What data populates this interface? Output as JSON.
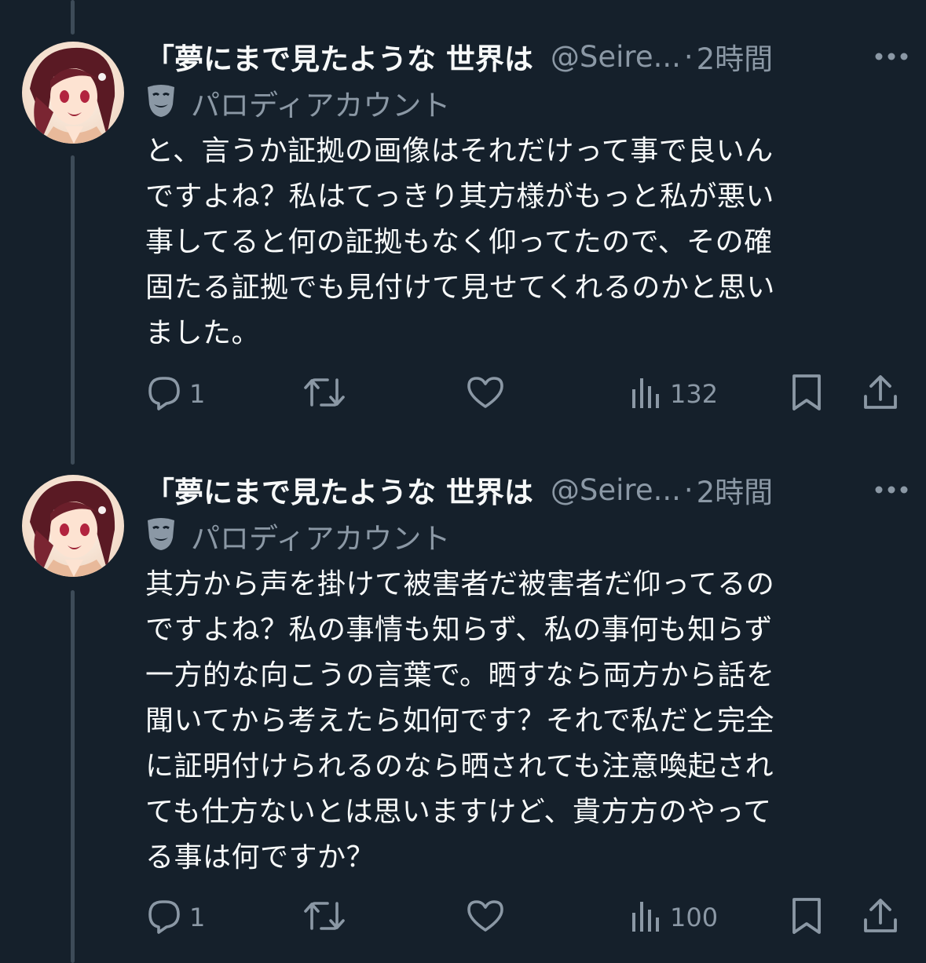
{
  "tweets": [
    {
      "display_name": "「夢にまで見たような 世界は",
      "handle": "@Seire...",
      "time": "2時間",
      "label": "パロディアカウント",
      "body": "と、言うか証拠の画像はそれだけって事で良いん\nですよね？私はてっきり其方様がもっと私が悪い\n事してると何の証拠もなく仰ってたので、その確\n固たる証拠でも見付けて見せてくれるのかと思い\nました。",
      "reply_count": "1",
      "view_count": "132"
    },
    {
      "display_name": "「夢にまで見たような 世界は",
      "handle": "@Seire...",
      "time": "2時間",
      "label": "パロディアカウント",
      "body": "其方から声を掛けて被害者だ被害者だ仰ってるの\nですよね？私の事情も知らず、私の事何も知らず\n一方的な向こうの言葉で。晒すなら両方から話を\n聞いてから考えたら如何です？それで私だと完全\nに証明付けられるのなら晒されても注意喚起され\nても仕方ないとは思いますけど、貴方方のやって\nる事は何ですか？",
      "reply_count": "1",
      "view_count": "100"
    }
  ],
  "separator": "·",
  "icons": {
    "more": "more-horizontal-icon",
    "label": "parody-mask-icon",
    "reply": "reply-icon",
    "retweet": "retweet-icon",
    "like": "like-icon",
    "views": "views-icon",
    "bookmark": "bookmark-icon",
    "share": "share-icon"
  },
  "colors": {
    "background": "#15202b",
    "text": "#f7f9f9",
    "secondary": "#8b98a5",
    "thread_line": "#3d4b58"
  }
}
